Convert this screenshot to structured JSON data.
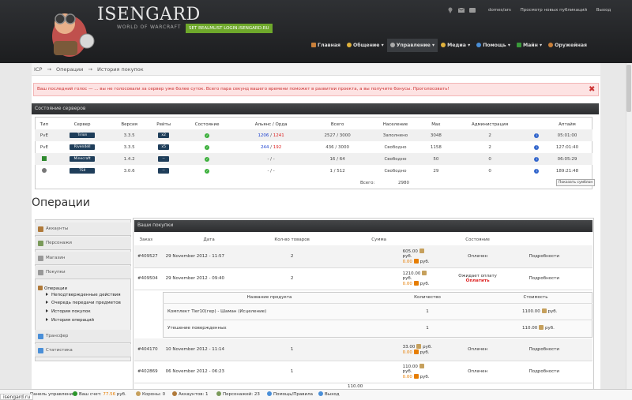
{
  "header": {
    "logo_title": "ISENGARD",
    "logo_subtitle": "WORLD OF WARCRAFT",
    "realmlist": "SET REALMLIST LOGIN.ISENGARD.RU",
    "user_name": "domes/ars",
    "news_link": "Просмотр новых публикаций",
    "logout": "Выход"
  },
  "nav": [
    {
      "label": "Главная",
      "icon": "home-icon",
      "color": "#c9803a"
    },
    {
      "label": "Общение ▾",
      "icon": "chat-icon",
      "color": "#e0b23c"
    },
    {
      "label": "Управление ▾",
      "icon": "gear-icon",
      "color": "#aaaaaa"
    },
    {
      "label": "Медиа ▾",
      "icon": "media-icon",
      "color": "#e0b23c"
    },
    {
      "label": "Помощь ▾",
      "icon": "help-icon",
      "color": "#4a8fd8"
    },
    {
      "label": "Майн ▾",
      "icon": "minecraft-icon",
      "color": "#3a9a3a"
    },
    {
      "label": "Оружейная",
      "icon": "armory-icon",
      "color": "#c9803a"
    }
  ],
  "breadcrumb": {
    "root": "ICP",
    "sep": "→",
    "level1": "Операции",
    "level2": "История покупок"
  },
  "alert": {
    "text": "Ваш последний голос — ... вы не голосовали за сервер уже более суток. Всего пара секунд вашего времени поможет в развитии проекта, а вы получите бонусы. Проголосовать!",
    "close": "✖"
  },
  "servers": {
    "title": "Состояние серверов",
    "columns": [
      "Тип",
      "Сервер",
      "Версия",
      "Рейты",
      "Состояние",
      "Альянс / Орда",
      "Всего",
      "Население",
      "Max",
      "Администрация",
      "",
      "Аптайм"
    ],
    "rows": [
      {
        "type": "PvE",
        "name": "Tirion",
        "version": "3.3.5",
        "rates": "x2",
        "alliance": "1206",
        "horde": "1241",
        "total": "2527 / 3000",
        "population": "Заполнено",
        "pop_color": "red",
        "max": "3048",
        "admins": "2",
        "uptime": "05:01:00"
      },
      {
        "type": "PvE",
        "name": "Rivendell",
        "version": "3.3.5",
        "rates": "x5",
        "alliance": "244",
        "horde": "192",
        "total": "436 / 3000",
        "population": "Свободно",
        "pop_color": "green",
        "max": "1158",
        "admins": "2",
        "uptime": "127:01:40"
      },
      {
        "type": "",
        "name": "Minecraft",
        "version": "1.4.2",
        "rates": "--",
        "alliance": "-",
        "horde": "-",
        "total": "16 / 64",
        "population": "Свободно",
        "pop_color": "green",
        "max": "50",
        "admins": "0",
        "uptime": "06:05:29"
      },
      {
        "type": "",
        "name": "TSII",
        "version": "3.0.6",
        "rates": "--",
        "alliance": "-",
        "horde": "-",
        "total": "1 / 512",
        "population": "Свободно",
        "pop_color": "green",
        "max": "29",
        "admins": "0",
        "uptime": "189:21:48"
      }
    ],
    "total_label": "Всего:",
    "total_value": "2980",
    "refresh": "Показать сумблон"
  },
  "page_title": "Операции",
  "sidebar": {
    "items": [
      {
        "label": "Аккаунты",
        "icon": "accounts-icon",
        "color": "#b07a3a"
      },
      {
        "label": "Персонажи",
        "icon": "characters-icon",
        "color": "#7a9a5a"
      },
      {
        "label": "Магазин",
        "icon": "shop-icon",
        "color": "#999999"
      },
      {
        "label": "Покупки",
        "icon": "purchases-icon",
        "color": "#999999"
      }
    ],
    "ops_label": "Операции",
    "sub": [
      "Неподтвержденные действия",
      "Очередь передачи предметов",
      "История покупок",
      "История операций"
    ],
    "items2": [
      {
        "label": "Трансфер",
        "icon": "transfer-icon",
        "color": "#4a8fd8"
      },
      {
        "label": "Статистика",
        "icon": "stats-icon",
        "color": "#4a8fd8"
      }
    ]
  },
  "orders": {
    "title": "Ваши покупки",
    "columns": [
      "Заказ",
      "Дата",
      "Кол-во товаров",
      "Сумма",
      "Состояние",
      ""
    ],
    "currency": "руб.",
    "details": "Подробности",
    "rows": [
      {
        "id": "#409527",
        "date": "29 November 2012 - 11:57",
        "count": "2",
        "sum": "605.00",
        "bonus": "0.00",
        "status": "Оплачен",
        "status2": ""
      },
      {
        "id": "#409504",
        "date": "29 November 2012 - 09:40",
        "count": "2",
        "sum": "1210.00",
        "bonus": "0.00",
        "status": "Ожидает оплату",
        "status2": "Оплатить"
      },
      {
        "id": "#404170",
        "date": "10 November 2012 - 11:14",
        "count": "1",
        "sum": "33.00",
        "bonus": "0.00",
        "status": "Оплачен",
        "status2": ""
      },
      {
        "id": "#402869",
        "date": "06 November 2012 - 06:23",
        "count": "1",
        "sum": "110.00",
        "bonus": "0.00",
        "status": "Оплачен",
        "status2": ""
      }
    ],
    "partial_sum": "110.00",
    "detail": {
      "columns": [
        "Название продукта",
        "Количество",
        "Стоимость"
      ],
      "rows": [
        {
          "name": "Комплект Tier10(гер) - Шаман (Исцеление)",
          "qty": "1",
          "price": "1100.00"
        },
        {
          "name": "Утешение повержденных",
          "qty": "1",
          "price": "110.00"
        }
      ]
    }
  },
  "statusbar": {
    "panel": "Панель управления",
    "balance_label": "Ваш счет:",
    "balance": "77.56",
    "currency": "руб.",
    "crowns": "Короны: 0",
    "accounts": "Аккаунтов: 1",
    "chars": "Персонажей: 23",
    "help": "Помощь/Правила",
    "logout": "Выход"
  },
  "url": "isengard.ru"
}
